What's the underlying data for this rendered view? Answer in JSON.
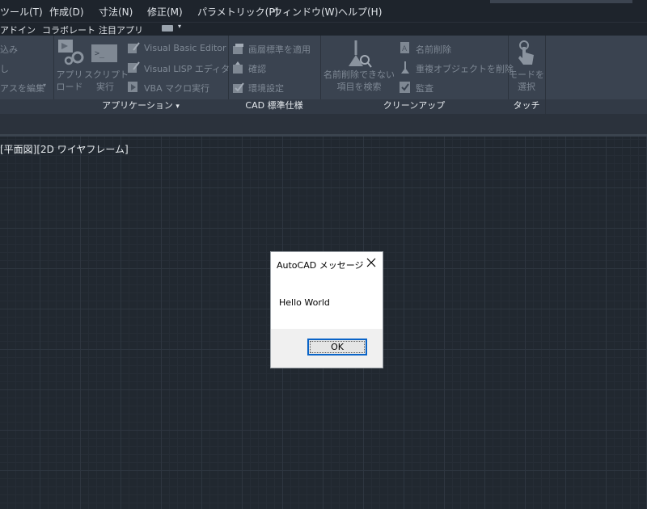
{
  "menubar": {
    "items": [
      "ツール(T)",
      "作成(D)",
      "寸法(N)",
      "修正(M)",
      "パラメトリック(P)",
      "ウィンドウ(W)",
      "ヘルプ(H)"
    ]
  },
  "ribbon_tabs": {
    "items": [
      "アドイン",
      "コラボレート",
      "注目アプリ"
    ]
  },
  "ribbon": {
    "left_partial": {
      "row1": "込み",
      "row2": "し",
      "row3": "アスを編集"
    },
    "applications": {
      "load_app": {
        "line1": "アプリ",
        "line2": "ロード"
      },
      "run_script": {
        "line1": "スクリプト",
        "line2": "実行"
      },
      "vba_editor": "Visual Basic Editor",
      "lisp_editor": "Visual LISP エディタ",
      "vba_macro": "VBA マクロ実行",
      "title": "アプリケーション"
    },
    "cad_standards": {
      "apply_layer": "画層標準を適用",
      "check": "確認",
      "settings": "環境設定",
      "title": "CAD 標準仕様"
    },
    "cleanup": {
      "find_nonpurgeable": {
        "line1": "名前削除できない",
        "line2": "項目を検索"
      },
      "purge": "名前削除",
      "delete_duplicates": "重複オブジェクトを削除",
      "audit": "監査",
      "title": "クリーンアップ"
    },
    "touch": {
      "select_mode": {
        "line1": "モードを",
        "line2": "選択"
      },
      "title": "タッチ"
    }
  },
  "viewport": {
    "label": "[平面図][2D ワイヤフレーム]"
  },
  "dialog": {
    "title": "AutoCAD メッセージ",
    "message": "Hello World",
    "ok_label": "OK"
  }
}
